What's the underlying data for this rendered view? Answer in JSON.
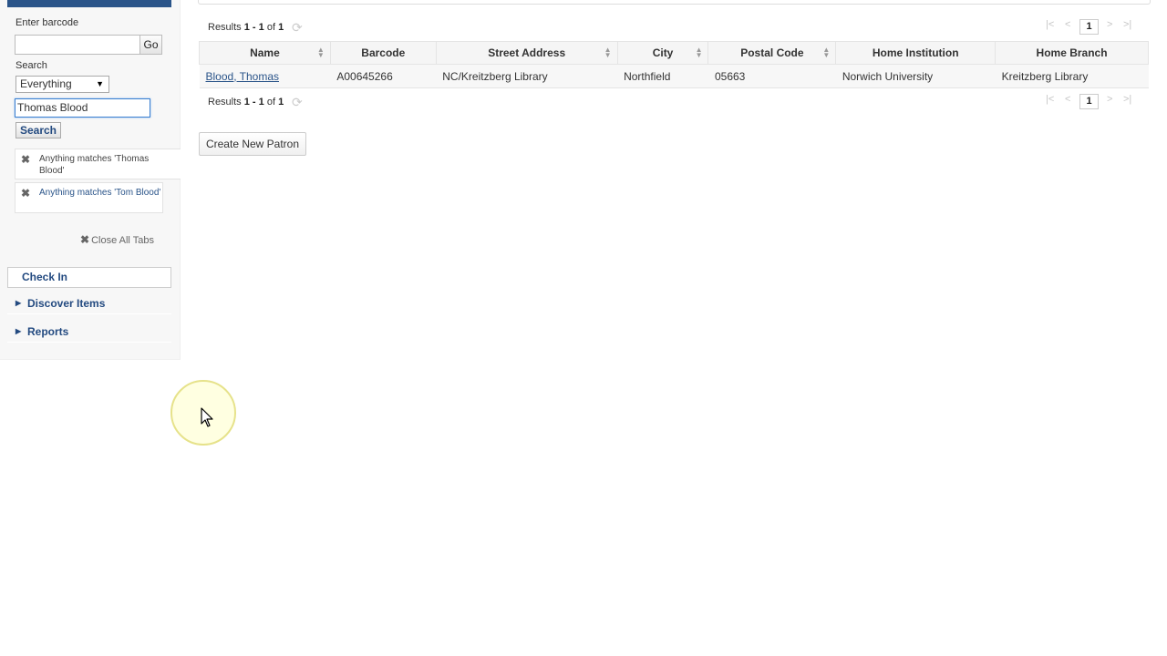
{
  "sidebar": {
    "barcode_label": "Enter barcode",
    "barcode_value": "",
    "go_label": "Go",
    "search_label": "Search",
    "scope_selected": "Everything",
    "search_value": "Thomas Blood",
    "search_button": "Search",
    "saved_searches": [
      {
        "label": "Anything matches 'Thomas Blood'",
        "active": true
      },
      {
        "label": "Anything matches 'Tom Blood'",
        "active": false
      }
    ],
    "close_all_tabs": "Close All Tabs",
    "nav": {
      "check_in": "Check In",
      "discover_items": "Discover Items",
      "reports": "Reports"
    }
  },
  "results": {
    "summary_prefix": "Results ",
    "range": "1 - 1",
    "of_text": " of ",
    "total": "1",
    "current_page": "1"
  },
  "table": {
    "columns": [
      "Name",
      "Barcode",
      "Street Address",
      "City",
      "Postal Code",
      "Home Institution",
      "Home Branch"
    ],
    "rows": [
      {
        "name": "Blood, Thomas",
        "barcode": "A00645266",
        "street_address": "NC/Kreitzberg Library",
        "city": "Northfield",
        "postal_code": "05663",
        "home_institution": "Norwich University",
        "home_branch": "Kreitzberg Library"
      }
    ]
  },
  "actions": {
    "create_new_patron": "Create New Patron"
  },
  "colors": {
    "accent": "#2a5489",
    "header_bar": "#2a5489"
  }
}
